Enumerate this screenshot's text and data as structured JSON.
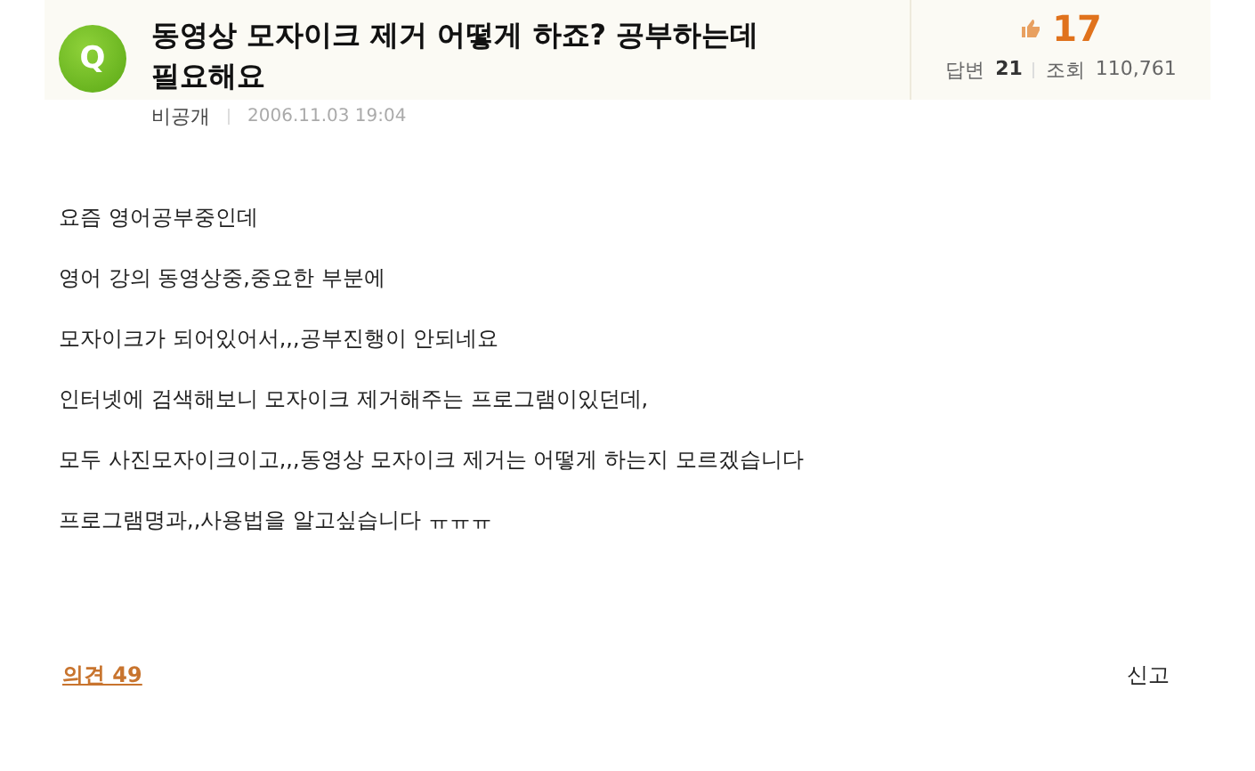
{
  "question": {
    "badge": "Q",
    "title": "동영상 모자이크 제거 어떻게 하죠? 공부하는데 필요해요",
    "likes": "17",
    "answers_label": "답변",
    "answers": "21",
    "views_label": "조회",
    "views": "110,761",
    "author": "비공개",
    "date": "2006.11.03 19:04"
  },
  "body": [
    "요즘 영어공부중인데",
    "영어 강의 동영상중,중요한 부분에",
    "모자이크가 되어있어서,,,공부진행이 안되네요",
    "인터넷에 검색해보니 모자이크 제거해주는 프로그램이있던데,",
    "모두 사진모자이크이고,,,동영상 모자이크 제거는 어떻게 하는지 모르겠습니다",
    "프로그램명과,,사용법을 알고싶습니다 ㅠㅠㅠ"
  ],
  "footer": {
    "comments": "의견 49",
    "report": "신고"
  }
}
